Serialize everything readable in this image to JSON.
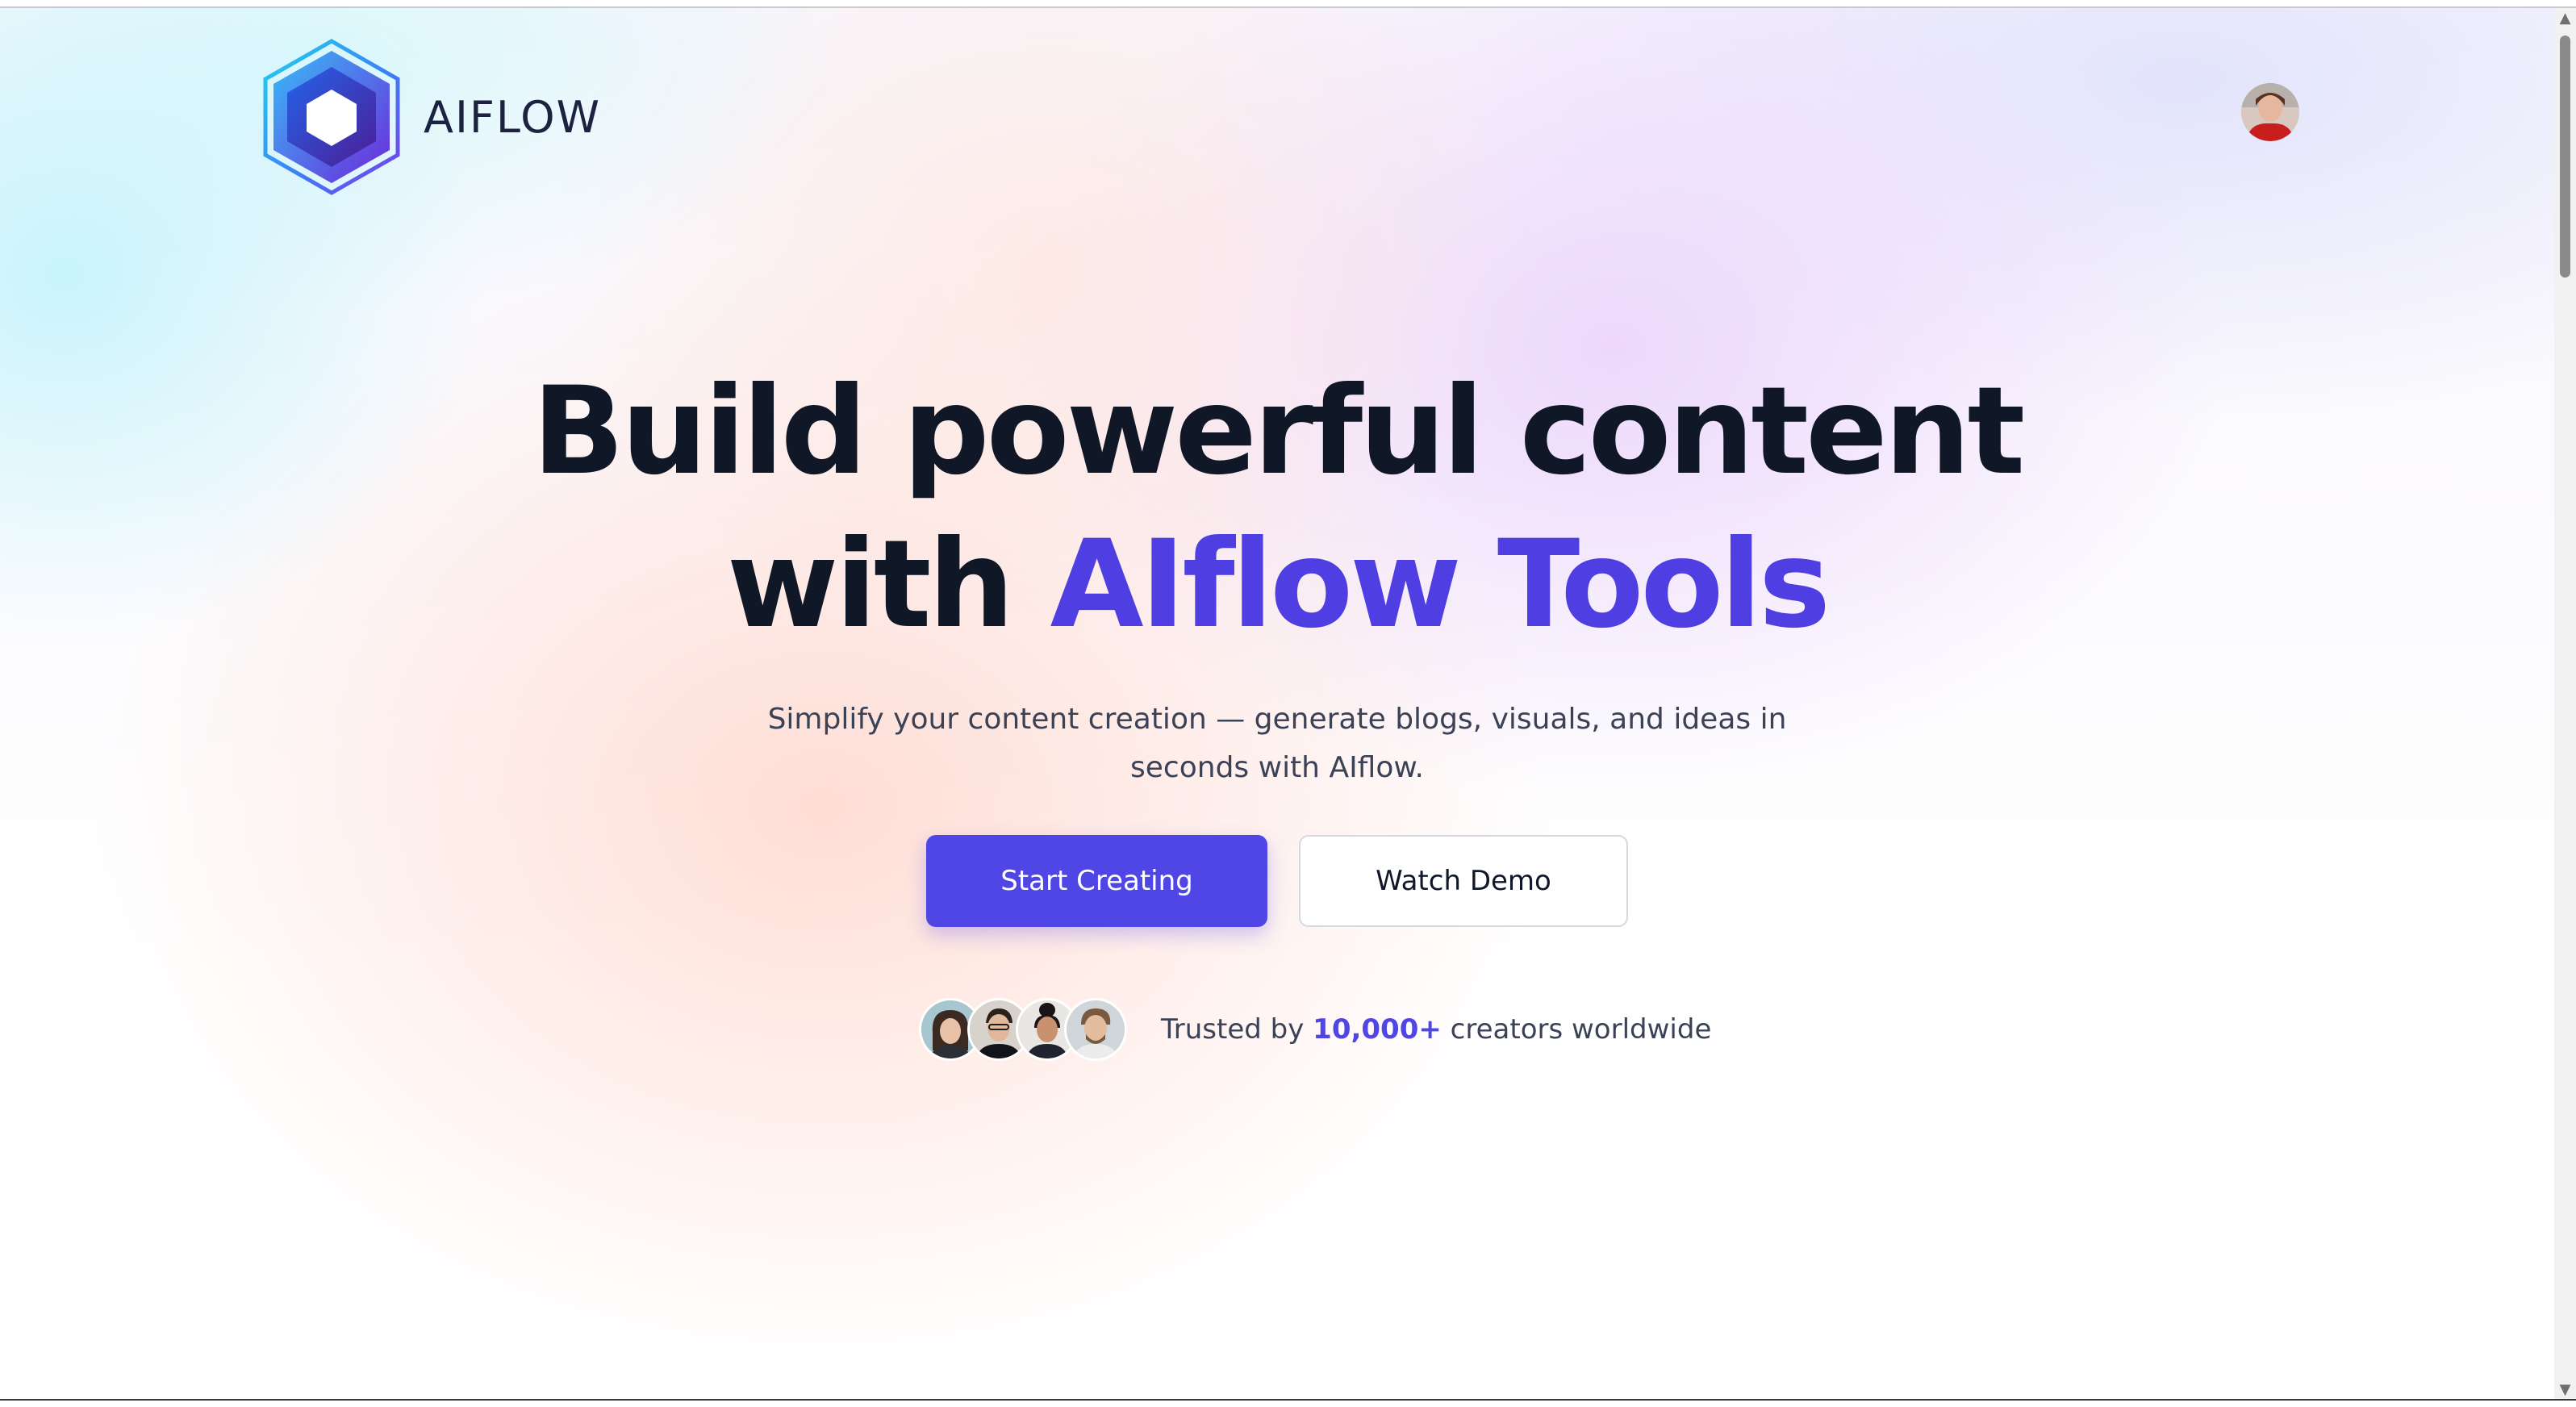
{
  "brand": {
    "name": "AIFLOW",
    "colors": {
      "accent": "#4f46e5",
      "heading": "#101828",
      "body_text": "#3b4256"
    }
  },
  "header": {
    "logo_icon": "hexagon-logo-icon",
    "profile_avatar": "user-avatar"
  },
  "hero": {
    "title_line1": "Build powerful content",
    "title_line2_prefix": "with ",
    "title_line2_accent": "AIflow Tools",
    "subtitle_line1": "Simplify your content creation — generate blogs, visuals, and ideas in",
    "subtitle_line2": "seconds with AIflow."
  },
  "actions": {
    "primary_label": "Start Creating",
    "secondary_label": "Watch Demo"
  },
  "trust": {
    "prefix": "Trusted by ",
    "count": "10,000+",
    "suffix": " creators worldwide",
    "avatars": [
      "creator-avatar-1",
      "creator-avatar-2",
      "creator-avatar-3",
      "creator-avatar-4"
    ]
  },
  "scrollbar": {
    "up_icon": "scroll-up-arrow-icon",
    "down_icon": "scroll-down-arrow-icon"
  }
}
